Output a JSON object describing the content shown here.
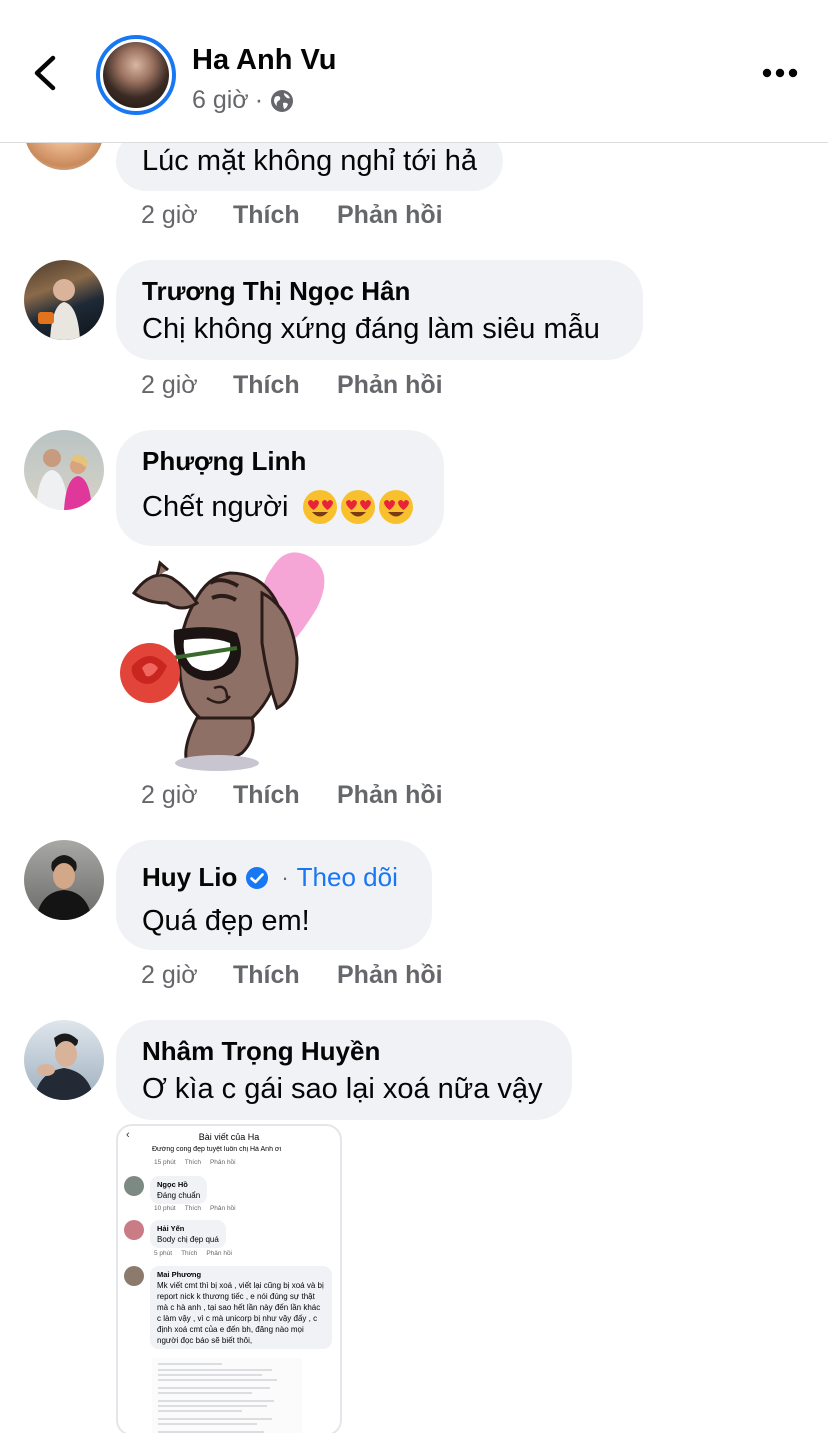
{
  "header": {
    "name": "Ha Anh Vu",
    "time": "6 giờ",
    "dot": "·"
  },
  "comments": [
    {
      "name": "",
      "text": "Lúc mặt không nghỉ tới hả",
      "time": "2 giờ",
      "like": "Thích",
      "reply": "Phản hồi"
    },
    {
      "name": "Trương Thị Ngọc Hân",
      "text": "Chị không xứng đáng làm siêu mẫu",
      "time": "2 giờ",
      "like": "Thích",
      "reply": "Phản hồi"
    },
    {
      "name": "Phượng Linh",
      "text": "Chết người",
      "time": "2 giờ",
      "like": "Thích",
      "reply": "Phản hồi"
    },
    {
      "name": "Huy Lio",
      "follow": "Theo dõi",
      "dot": "·",
      "text": "Quá đẹp em!",
      "time": "2 giờ",
      "like": "Thích",
      "reply": "Phản hồi"
    },
    {
      "name": "Nhâm Trọng Huyền",
      "text": "Ơ kìa c gái sao lại xoá nữa vậy"
    }
  ],
  "screenshot": {
    "title": "Bài viết của Ha",
    "top_text": "Đường cong đẹp tuyệt luôn chị Hà Anh ơi",
    "rows": [
      {
        "name": "",
        "text": "",
        "time": "15 phút",
        "like": "Thích",
        "reply": "Phản hồi"
      },
      {
        "name": "Ngọc Hồ",
        "text": "Đáng chuẩn",
        "time": "10 phút",
        "like": "Thích",
        "reply": "Phản hồi"
      },
      {
        "name": "Hải Yến",
        "text": "Body chị đẹp quá",
        "time": "5 phút",
        "like": "Thích",
        "reply": "Phản hồi"
      },
      {
        "name": "Mai Phương",
        "text": "Mk viết cmt thì bị xoá , viết lại cũng bị xoá và bị report nick k thương tiếc , e nói đúng sự thật mà c hà anh , tại sao hết lần này đến lần khác c làm vậy , vì c mà unicorp bị như vậy đấy , c định xoá cmt của e đến bh, đăng nào mọi người đọc báo sẽ biết thôi,"
      }
    ]
  },
  "colors": {
    "accent": "#1877f2",
    "bubble": "#f0f2f5",
    "secondary_text": "#65676b"
  }
}
